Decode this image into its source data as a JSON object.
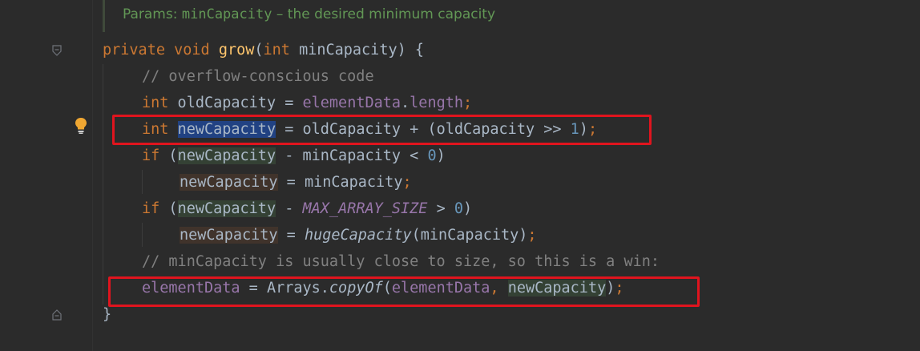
{
  "doc_comment": {
    "label": "Params: ",
    "param": "minCapacity",
    "desc": " – the desired minimum capacity"
  },
  "code": {
    "l1": {
      "kw1": "private",
      "kw2": "void",
      "fn": "grow",
      "p1": "(",
      "kw3": "int",
      "p2": " minCapacity) {"
    },
    "l2": {
      "comment": "// overflow-conscious code"
    },
    "l3": {
      "kw": "int",
      "p1": " oldCapacity = ",
      "field": "elementData",
      "p2": ".",
      "field2": "length",
      "semi": ";"
    },
    "l4": {
      "kw": "int",
      "var": "newCapacity",
      "p1": " = oldCapacity + (oldCapacity >> ",
      "num": "1",
      "p2": ")",
      "semi": ";"
    },
    "l5": {
      "kw": "if",
      "p1": " (",
      "var": "newCapacity",
      "p2": " - minCapacity < ",
      "num": "0",
      "p3": ")"
    },
    "l6": {
      "var": "newCapacity",
      "p1": " = minCapacity",
      "semi": ";"
    },
    "l7": {
      "kw": "if",
      "p1": " (",
      "var": "newCapacity",
      "p2": " - ",
      "const": "MAX_ARRAY_SIZE",
      "p3": " > ",
      "num": "0",
      "p4": ")"
    },
    "l8": {
      "var": "newCapacity",
      "p1": " = ",
      "fn": "hugeCapacity",
      "p2": "(minCapacity)",
      "semi": ";"
    },
    "l9": {
      "comment": "// minCapacity is usually close to size, so this is a win:"
    },
    "l10": {
      "field": "elementData",
      "p1": " = Arrays.",
      "fn": "copyOf",
      "p2": "(",
      "field2": "elementData",
      "comma": ",",
      "p3": " ",
      "var": "newCapacity",
      "p4": ")",
      "semi": ";"
    },
    "l11": {
      "brace": "}"
    }
  },
  "colors": {
    "background": "#2b2b2b",
    "keyword": "#cc7832",
    "method": "#ffc66d",
    "field": "#9876aa",
    "comment": "#808080",
    "doc": "#629755",
    "number": "#6897bb",
    "highlight_box": "#e0141e"
  },
  "icons": {
    "fold_open": "fold-open-icon",
    "fold_close": "fold-close-icon",
    "intention": "lightbulb-icon"
  }
}
